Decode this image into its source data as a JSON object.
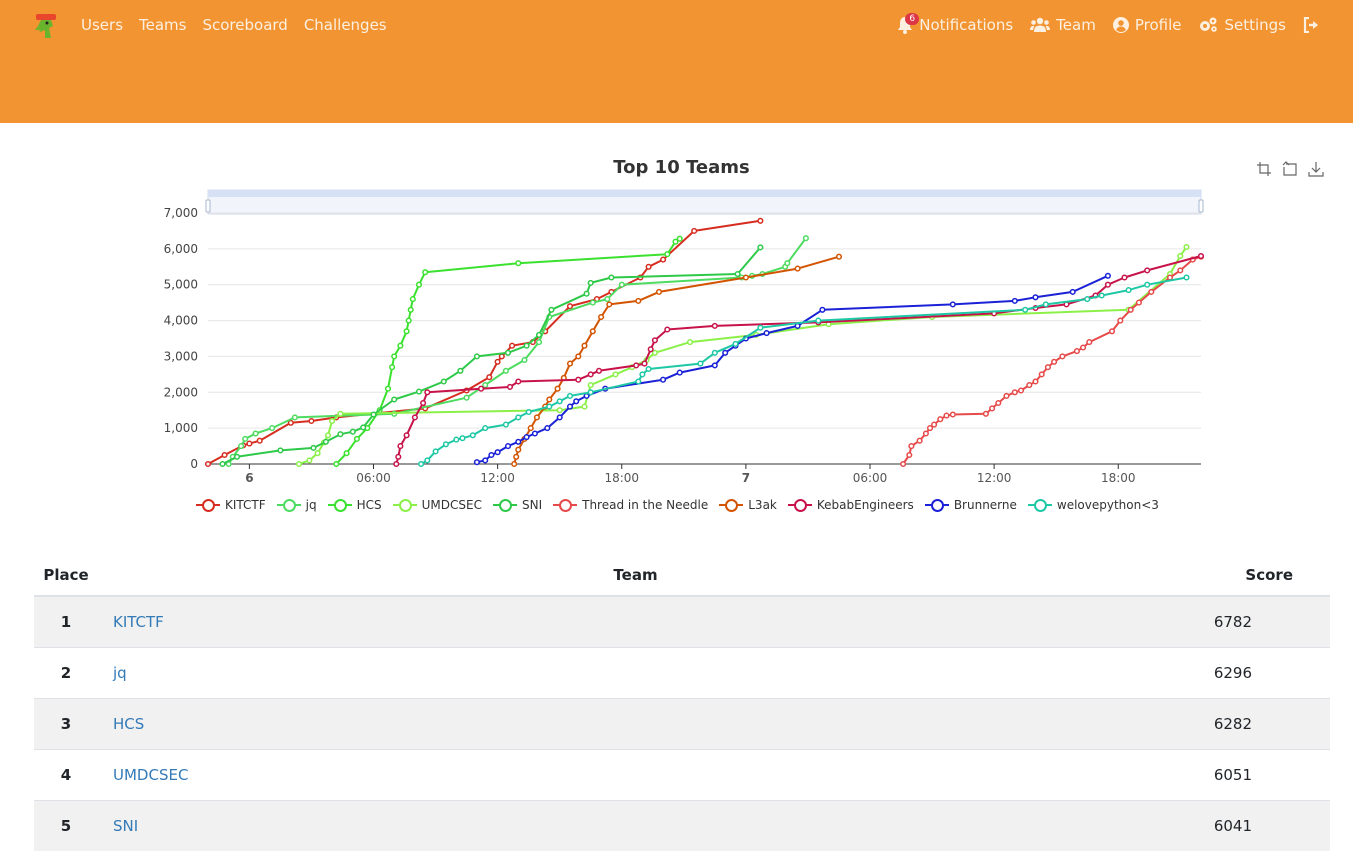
{
  "nav": {
    "left": [
      "Users",
      "Teams",
      "Scoreboard",
      "Challenges"
    ],
    "notifications": "Notifications",
    "notification_count": "6",
    "team": "Team",
    "profile": "Profile",
    "settings": "Settings"
  },
  "colors": {
    "navbar": "#f29431",
    "link": "#337ab7"
  },
  "chart_data": {
    "type": "line",
    "title": "Top 10 Teams",
    "ylim": [
      0,
      7000
    ],
    "y_ticks": [
      "0",
      "1,000",
      "2,000",
      "3,000",
      "4,000",
      "5,000",
      "6,000",
      "7,000"
    ],
    "x_ticks": [
      "6",
      "06:00",
      "12:00",
      "18:00",
      "7",
      "06:00",
      "12:00",
      "18:00"
    ],
    "x_domain_hours": [
      -2,
      46
    ],
    "legend_position": "bottom",
    "grid": true,
    "series": [
      {
        "name": "KITCTF",
        "color": "#d62d20",
        "points": [
          [
            -2,
            0
          ],
          [
            -1.2,
            250
          ],
          [
            -0.3,
            520
          ],
          [
            0,
            570
          ],
          [
            0.5,
            650
          ],
          [
            2,
            1150
          ],
          [
            3,
            1200
          ],
          [
            4.2,
            1300
          ],
          [
            8.5,
            1550
          ],
          [
            10.5,
            2050
          ],
          [
            11.6,
            2420
          ],
          [
            12,
            2850
          ],
          [
            12.2,
            3000
          ],
          [
            12.7,
            3300
          ],
          [
            13.7,
            3400
          ],
          [
            14.3,
            3700
          ],
          [
            15.5,
            4400
          ],
          [
            16.8,
            4600
          ],
          [
            17.5,
            4800
          ],
          [
            18.9,
            5200
          ],
          [
            19.3,
            5500
          ],
          [
            20,
            5700
          ],
          [
            21.5,
            6500
          ],
          [
            24.7,
            6782
          ]
        ]
      },
      {
        "name": "jq",
        "color": "#4ddb60",
        "points": [
          [
            -1,
            0
          ],
          [
            -0.8,
            200
          ],
          [
            -0.4,
            500
          ],
          [
            -0.2,
            700
          ],
          [
            0.3,
            850
          ],
          [
            1.1,
            1000
          ],
          [
            2.2,
            1300
          ],
          [
            7,
            1400
          ],
          [
            10.5,
            1850
          ],
          [
            11.4,
            2200
          ],
          [
            12.4,
            2600
          ],
          [
            13.3,
            2900
          ],
          [
            14,
            3400
          ],
          [
            14.5,
            4100
          ],
          [
            16.6,
            4500
          ],
          [
            17.3,
            4600
          ],
          [
            18,
            5000
          ],
          [
            23.8,
            5200
          ],
          [
            24.3,
            5250
          ],
          [
            24.8,
            5300
          ],
          [
            25.9,
            5500
          ],
          [
            26,
            5600
          ],
          [
            26.9,
            6296
          ]
        ]
      },
      {
        "name": "HCS",
        "color": "#3ae12e",
        "points": [
          [
            4.2,
            0
          ],
          [
            4.7,
            300
          ],
          [
            5.2,
            700
          ],
          [
            5.7,
            1000
          ],
          [
            6.3,
            1500
          ],
          [
            6.7,
            2100
          ],
          [
            6.9,
            2700
          ],
          [
            7,
            3000
          ],
          [
            7.3,
            3300
          ],
          [
            7.6,
            3700
          ],
          [
            7.7,
            4000
          ],
          [
            7.8,
            4300
          ],
          [
            7.9,
            4600
          ],
          [
            8.2,
            5000
          ],
          [
            8.5,
            5350
          ],
          [
            13,
            5600
          ],
          [
            20.2,
            5850
          ],
          [
            20.6,
            6200
          ],
          [
            20.8,
            6282
          ]
        ]
      },
      {
        "name": "UMDCSEC",
        "color": "#8bf048",
        "points": [
          [
            2.4,
            0
          ],
          [
            2.9,
            100
          ],
          [
            3.3,
            300
          ],
          [
            3.6,
            600
          ],
          [
            3.8,
            800
          ],
          [
            4,
            1200
          ],
          [
            4.4,
            1400
          ],
          [
            15,
            1500
          ],
          [
            16.2,
            1600
          ],
          [
            16.5,
            2200
          ],
          [
            17.7,
            2500
          ],
          [
            18.5,
            2700
          ],
          [
            19.2,
            2900
          ],
          [
            19.6,
            3100
          ],
          [
            21.3,
            3400
          ],
          [
            24.5,
            3600
          ],
          [
            28,
            3900
          ],
          [
            33,
            4100
          ],
          [
            42.5,
            4300
          ],
          [
            44.5,
            5300
          ],
          [
            45,
            5800
          ],
          [
            45.3,
            6051
          ]
        ]
      },
      {
        "name": "SNI",
        "color": "#2ec949",
        "points": [
          [
            -1.3,
            0
          ],
          [
            -0.6,
            200
          ],
          [
            1.5,
            380
          ],
          [
            3.1,
            450
          ],
          [
            3.7,
            620
          ],
          [
            4.4,
            830
          ],
          [
            5,
            900
          ],
          [
            5.5,
            1020
          ],
          [
            6,
            1380
          ],
          [
            7,
            1800
          ],
          [
            8.2,
            2020
          ],
          [
            9.4,
            2300
          ],
          [
            10.2,
            2600
          ],
          [
            11,
            3000
          ],
          [
            12.5,
            3100
          ],
          [
            13.4,
            3300
          ],
          [
            14,
            3600
          ],
          [
            14.6,
            4300
          ],
          [
            16.3,
            4750
          ],
          [
            16.5,
            5050
          ],
          [
            17.5,
            5200
          ],
          [
            23.6,
            5300
          ],
          [
            24.7,
            6041
          ]
        ]
      },
      {
        "name": "Thread in the Needle",
        "color": "#e64a4a",
        "points": [
          [
            31.6,
            0
          ],
          [
            31.9,
            250
          ],
          [
            32,
            500
          ],
          [
            32.4,
            650
          ],
          [
            32.7,
            850
          ],
          [
            32.9,
            1000
          ],
          [
            33.1,
            1100
          ],
          [
            33.4,
            1250
          ],
          [
            33.7,
            1350
          ],
          [
            34,
            1380
          ],
          [
            35.6,
            1400
          ],
          [
            35.9,
            1550
          ],
          [
            36.2,
            1700
          ],
          [
            36.6,
            1900
          ],
          [
            37,
            2000
          ],
          [
            37.3,
            2050
          ],
          [
            37.7,
            2200
          ],
          [
            38,
            2300
          ],
          [
            38.3,
            2500
          ],
          [
            38.6,
            2700
          ],
          [
            38.9,
            2850
          ],
          [
            39.3,
            3000
          ],
          [
            40,
            3150
          ],
          [
            40.3,
            3250
          ],
          [
            40.6,
            3400
          ],
          [
            41.7,
            3700
          ],
          [
            42.1,
            4000
          ],
          [
            42.6,
            4300
          ],
          [
            43,
            4500
          ],
          [
            43.6,
            4800
          ],
          [
            44.5,
            5200
          ],
          [
            45,
            5400
          ],
          [
            45.6,
            5700
          ],
          [
            46,
            5780
          ]
        ]
      },
      {
        "name": "L3ak",
        "color": "#d35400",
        "points": [
          [
            12.8,
            0
          ],
          [
            12.9,
            200
          ],
          [
            13,
            400
          ],
          [
            13.3,
            700
          ],
          [
            13.6,
            1000
          ],
          [
            13.9,
            1300
          ],
          [
            14.3,
            1600
          ],
          [
            14.5,
            1800
          ],
          [
            14.9,
            2100
          ],
          [
            15.2,
            2400
          ],
          [
            15.5,
            2800
          ],
          [
            15.9,
            3000
          ],
          [
            16.2,
            3300
          ],
          [
            16.6,
            3700
          ],
          [
            17,
            4100
          ],
          [
            17.4,
            4450
          ],
          [
            18.8,
            4550
          ],
          [
            19.8,
            4800
          ],
          [
            24,
            5200
          ],
          [
            26.5,
            5450
          ],
          [
            28.5,
            5780
          ]
        ]
      },
      {
        "name": "KebabEngineers",
        "color": "#c7134a",
        "points": [
          [
            7.1,
            0
          ],
          [
            7.2,
            200
          ],
          [
            7.3,
            500
          ],
          [
            7.6,
            800
          ],
          [
            8,
            1300
          ],
          [
            8.4,
            1700
          ],
          [
            8.6,
            2000
          ],
          [
            11.2,
            2100
          ],
          [
            12.6,
            2150
          ],
          [
            13,
            2300
          ],
          [
            15.9,
            2350
          ],
          [
            16.5,
            2500
          ],
          [
            16.9,
            2600
          ],
          [
            18.7,
            2750
          ],
          [
            19.1,
            2800
          ],
          [
            19.4,
            3200
          ],
          [
            19.6,
            3450
          ],
          [
            20.2,
            3750
          ],
          [
            22.5,
            3850
          ],
          [
            27.5,
            3950
          ],
          [
            36,
            4200
          ],
          [
            38,
            4350
          ],
          [
            39.5,
            4450
          ],
          [
            40.9,
            4700
          ],
          [
            41.5,
            5000
          ],
          [
            42.3,
            5200
          ],
          [
            43.4,
            5400
          ],
          [
            46,
            5800
          ]
        ]
      },
      {
        "name": "Brunnerne",
        "color": "#1a21d6",
        "points": [
          [
            11,
            50
          ],
          [
            11.4,
            100
          ],
          [
            11.7,
            250
          ],
          [
            12,
            330
          ],
          [
            12.5,
            500
          ],
          [
            13,
            620
          ],
          [
            13.4,
            750
          ],
          [
            13.8,
            850
          ],
          [
            14.4,
            1000
          ],
          [
            15,
            1300
          ],
          [
            15.5,
            1600
          ],
          [
            15.8,
            1750
          ],
          [
            16.3,
            1900
          ],
          [
            17.2,
            2100
          ],
          [
            20,
            2350
          ],
          [
            20.8,
            2550
          ],
          [
            22.5,
            2750
          ],
          [
            23,
            3100
          ],
          [
            23.5,
            3300
          ],
          [
            24,
            3500
          ],
          [
            25,
            3650
          ],
          [
            26.5,
            3850
          ],
          [
            27.7,
            4300
          ],
          [
            34,
            4450
          ],
          [
            37,
            4550
          ],
          [
            38,
            4650
          ],
          [
            39.8,
            4800
          ],
          [
            41.5,
            5250
          ]
        ]
      },
      {
        "name": "welovepython<3",
        "color": "#1ec8a5",
        "points": [
          [
            8.3,
            0
          ],
          [
            8.6,
            100
          ],
          [
            9,
            350
          ],
          [
            9.5,
            550
          ],
          [
            10,
            680
          ],
          [
            10.3,
            720
          ],
          [
            10.8,
            800
          ],
          [
            11.4,
            1000
          ],
          [
            12.4,
            1100
          ],
          [
            13,
            1300
          ],
          [
            13.5,
            1450
          ],
          [
            14.5,
            1600
          ],
          [
            15,
            1750
          ],
          [
            15.5,
            1900
          ],
          [
            16.5,
            2000
          ],
          [
            18.8,
            2300
          ],
          [
            19,
            2500
          ],
          [
            19.3,
            2650
          ],
          [
            21.8,
            2800
          ],
          [
            22.5,
            3100
          ],
          [
            23.5,
            3350
          ],
          [
            24.7,
            3800
          ],
          [
            27.5,
            4000
          ],
          [
            37.5,
            4300
          ],
          [
            38.5,
            4450
          ],
          [
            40.5,
            4600
          ],
          [
            41.2,
            4700
          ],
          [
            42.5,
            4850
          ],
          [
            43.4,
            5000
          ],
          [
            45.3,
            5200
          ]
        ]
      }
    ]
  },
  "table": {
    "headers": {
      "place": "Place",
      "team": "Team",
      "score": "Score"
    },
    "rows": [
      {
        "place": "1",
        "team": "KITCTF",
        "score": "6782"
      },
      {
        "place": "2",
        "team": "jq",
        "score": "6296"
      },
      {
        "place": "3",
        "team": "HCS",
        "score": "6282"
      },
      {
        "place": "4",
        "team": "UMDCSEC",
        "score": "6051"
      },
      {
        "place": "5",
        "team": "SNI",
        "score": "6041"
      }
    ]
  }
}
